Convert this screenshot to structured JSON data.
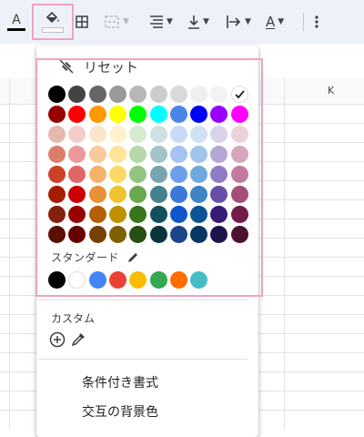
{
  "toolbar": {
    "text_color_letter": "A",
    "text_color_bar": "#000000",
    "fill_color_bar": "#ffffff",
    "text_rotation_letter": "A",
    "more_icon": "more-vert"
  },
  "column_headers": [
    "K"
  ],
  "fill_menu": {
    "reset_label": "リセット",
    "palette_rows": [
      [
        "#000000",
        "#434343",
        "#666666",
        "#999999",
        "#b7b7b7",
        "#cccccc",
        "#d9d9d9",
        "#efefef",
        "#f3f3f3",
        "#ffffff"
      ],
      [
        "#980000",
        "#ff0000",
        "#ff9900",
        "#ffff00",
        "#00ff00",
        "#00ffff",
        "#4a86e8",
        "#0000ff",
        "#9900ff",
        "#ff00ff"
      ],
      [
        "#e6b8af",
        "#f4cccc",
        "#fce5cd",
        "#fff2cc",
        "#d9ead3",
        "#d0e0e3",
        "#c9daf8",
        "#cfe2f3",
        "#d9d2e9",
        "#ead1dc"
      ],
      [
        "#dd7e6b",
        "#ea9999",
        "#f9cb9c",
        "#ffe599",
        "#b6d7a8",
        "#a2c4c9",
        "#a4c2f4",
        "#9fc5e8",
        "#b4a7d6",
        "#d5a6bd"
      ],
      [
        "#cc4125",
        "#e06666",
        "#f6b26b",
        "#ffd966",
        "#93c47d",
        "#76a5af",
        "#6d9eeb",
        "#6fa8dc",
        "#8e7cc3",
        "#c27ba0"
      ],
      [
        "#a61c00",
        "#cc0000",
        "#e69138",
        "#f1c232",
        "#6aa84f",
        "#45818e",
        "#3c78d8",
        "#3d85c6",
        "#674ea7",
        "#a64d79"
      ],
      [
        "#85200c",
        "#990000",
        "#b45f06",
        "#bf9000",
        "#38761d",
        "#134f5c",
        "#1155cc",
        "#0b5394",
        "#351c75",
        "#741b47"
      ],
      [
        "#5b0f00",
        "#660000",
        "#783f04",
        "#7f6000",
        "#274e13",
        "#0c343d",
        "#1c4587",
        "#073763",
        "#20124d",
        "#4c1130"
      ]
    ],
    "standard_label": "スタンダード",
    "standard_colors": [
      "#000000",
      "#ffffff",
      "#4285f4",
      "#ea4335",
      "#fbbc04",
      "#34a853",
      "#ff6d01",
      "#46bdc6"
    ],
    "custom_label": "カスタム",
    "conditional_format_label": "条件付き書式",
    "alternating_colors_label": "交互の背景色"
  }
}
